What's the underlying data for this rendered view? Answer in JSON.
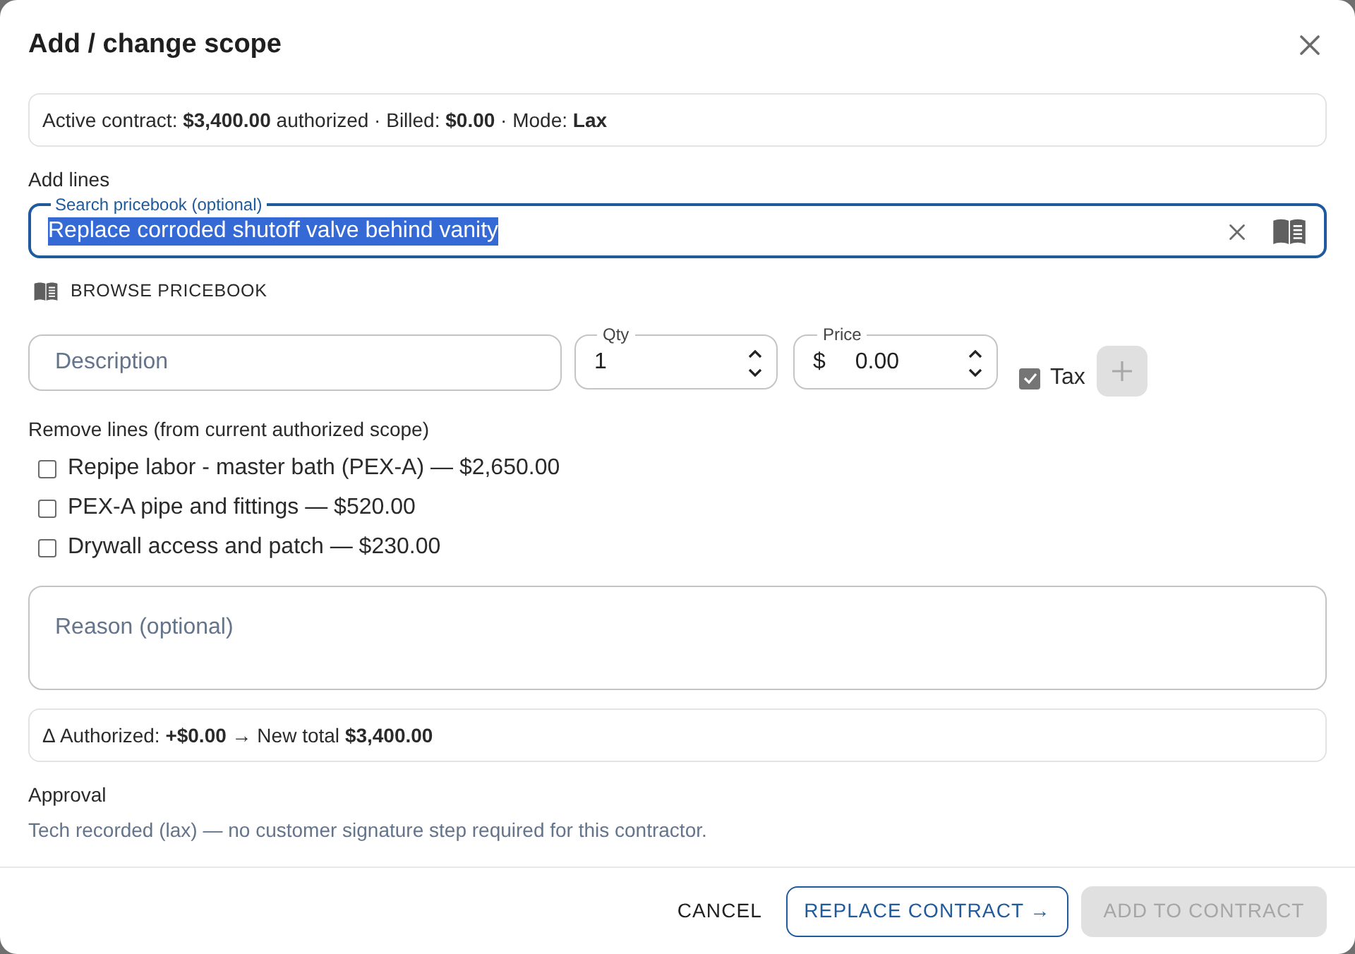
{
  "dialog": {
    "title": "Add / change scope"
  },
  "contract_summary": {
    "text": "Active contract: **$3,400.00** authorized · Billed: **$0.00** · Mode: **Lax**"
  },
  "add_lines": {
    "heading": "Add lines",
    "search": {
      "label": "Search pricebook (optional)",
      "value": "Replace corroded shutoff valve behind vanity",
      "value_selected": true
    },
    "browse_button": {
      "label": "BROWSE PRICEBOOK"
    }
  },
  "new_line": {
    "description": {
      "placeholder": "Description"
    },
    "qty": {
      "label": "Qty",
      "value": "1"
    },
    "price": {
      "label": "Price",
      "prefix": "$",
      "value": "0.00"
    },
    "tax": {
      "label": "Tax",
      "checked": true
    },
    "add_button": {
      "disabled": true
    }
  },
  "remove_lines": {
    "heading": "Remove lines (from current authorized scope)",
    "items": [
      {
        "label": "Repipe labor - master bath (PEX-A) — $2,650.00",
        "checked": false
      },
      {
        "label": "PEX-A pipe and fittings — $520.00",
        "checked": false
      },
      {
        "label": "Drywall access and patch — $230.00",
        "checked": false
      }
    ]
  },
  "reason": {
    "placeholder": "Reason (optional)"
  },
  "delta": {
    "text": "Δ Authorized: **+$0.00** → New total **$3,400.00**"
  },
  "approval": {
    "heading": "Approval",
    "text": "Tech recorded (lax) — no customer signature step required for this contractor."
  },
  "footer": {
    "buttons": [
      {
        "label": "CANCEL",
        "kind": "text",
        "disabled": false
      },
      {
        "label": "REPLACE CONTRACT →",
        "kind": "outlined",
        "disabled": false
      },
      {
        "label": "ADD TO CONTRACT",
        "kind": "contained",
        "disabled": true
      }
    ]
  }
}
